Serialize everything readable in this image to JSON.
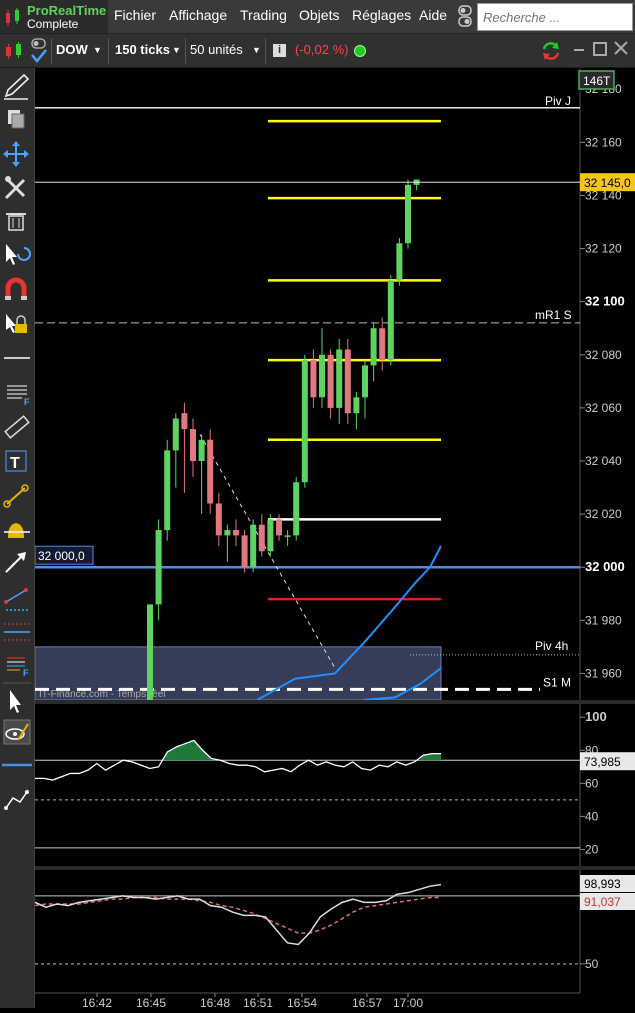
{
  "app": {
    "name": "ProRealTime",
    "edition": "Complete"
  },
  "menu": [
    "Fichier",
    "Affichage",
    "Trading",
    "Objets",
    "Réglages",
    "Aide"
  ],
  "search": {
    "placeholder": "Recherche ..."
  },
  "toolbar": {
    "instrument": "DOW",
    "period": "150 ticks",
    "units": "50 unités",
    "change": "(-0,02 %)",
    "colors": {
      "change": "#ff4444",
      "status": "#22cc22"
    }
  },
  "tools": [
    "pencil-icon",
    "copy-icon",
    "move-icon",
    "tools-icon",
    "trash-icon",
    "cursor-undo-icon",
    "magnet-icon",
    "lock-cursor-icon",
    "horizontal-line-icon",
    "fibonacci-icon",
    "ruler-icon",
    "text-icon",
    "segment-icon",
    "alert-icon",
    "arrow-icon",
    "channel-icon",
    "fork-icon",
    "fan-icon",
    "pointer-icon",
    "eye-pencil-icon",
    "blue-line-icon",
    "polyline-icon"
  ],
  "chart_data": [
    {
      "type": "candlestick",
      "ticks_badge": "146T",
      "ylim": [
        31950,
        32188
      ],
      "yticks": [
        "32 180",
        "32 160",
        "32 140",
        "32 120",
        "32 100",
        "32 080",
        "32 060",
        "32 040",
        "32 020",
        "32 000",
        "31 980",
        "31 960"
      ],
      "price_marker": "32 145,0",
      "level_marker": "32 000,0",
      "watermark": "IT-Finance.com - Temps réel",
      "level_labels": {
        "piv_j": "Piv J",
        "mr1_s": "mR1 S",
        "piv_4h": "Piv 4h",
        "s1_m": "S1 M"
      },
      "levels": {
        "piv_j": 32173,
        "mr1_s": 32092,
        "piv_4h": 31967,
        "s1_m": 31954,
        "blue": 32000
      },
      "fib_lines": {
        "yellow": [
          32168,
          32139,
          32108,
          32078,
          32048
        ],
        "white": 32018,
        "red": 31988
      },
      "candles": [
        {
          "o": 31950,
          "h": 31986,
          "l": 31950,
          "c": 31986
        },
        {
          "o": 31986,
          "h": 32018,
          "l": 31980,
          "c": 32014
        },
        {
          "o": 32014,
          "h": 32048,
          "l": 32010,
          "c": 32044
        },
        {
          "o": 32044,
          "h": 32058,
          "l": 32030,
          "c": 32056
        },
        {
          "o": 32058,
          "h": 32062,
          "l": 32028,
          "c": 32052
        },
        {
          "o": 32052,
          "h": 32056,
          "l": 32034,
          "c": 32040
        },
        {
          "o": 32040,
          "h": 32050,
          "l": 32020,
          "c": 32048
        },
        {
          "o": 32048,
          "h": 32052,
          "l": 32020,
          "c": 32024
        },
        {
          "o": 32024,
          "h": 32028,
          "l": 32008,
          "c": 32012
        },
        {
          "o": 32012,
          "h": 32016,
          "l": 32002,
          "c": 32014
        },
        {
          "o": 32014,
          "h": 32018,
          "l": 32008,
          "c": 32012
        },
        {
          "o": 32012,
          "h": 32014,
          "l": 31998,
          "c": 32000
        },
        {
          "o": 32000,
          "h": 32018,
          "l": 31998,
          "c": 32016
        },
        {
          "o": 32016,
          "h": 32020,
          "l": 32004,
          "c": 32006
        },
        {
          "o": 32006,
          "h": 32020,
          "l": 32004,
          "c": 32018
        },
        {
          "o": 32018,
          "h": 32020,
          "l": 32010,
          "c": 32012
        },
        {
          "o": 32012,
          "h": 32014,
          "l": 32008,
          "c": 32012
        },
        {
          "o": 32012,
          "h": 32034,
          "l": 32010,
          "c": 32032
        },
        {
          "o": 32032,
          "h": 32080,
          "l": 32030,
          "c": 32078
        },
        {
          "o": 32078,
          "h": 32082,
          "l": 32060,
          "c": 32064
        },
        {
          "o": 32064,
          "h": 32090,
          "l": 32060,
          "c": 32080
        },
        {
          "o": 32080,
          "h": 32082,
          "l": 32056,
          "c": 32060
        },
        {
          "o": 32060,
          "h": 32086,
          "l": 32054,
          "c": 32082
        },
        {
          "o": 32082,
          "h": 32086,
          "l": 32054,
          "c": 32058
        },
        {
          "o": 32058,
          "h": 32066,
          "l": 32052,
          "c": 32064
        },
        {
          "o": 32064,
          "h": 32078,
          "l": 32056,
          "c": 32076
        },
        {
          "o": 32076,
          "h": 32092,
          "l": 32070,
          "c": 32090
        },
        {
          "o": 32090,
          "h": 32094,
          "l": 32074,
          "c": 32078
        },
        {
          "o": 32078,
          "h": 32110,
          "l": 32076,
          "c": 32108
        },
        {
          "o": 32108,
          "h": 32124,
          "l": 32106,
          "c": 32122
        },
        {
          "o": 32122,
          "h": 32146,
          "l": 32120,
          "c": 32144
        },
        {
          "o": 32144,
          "h": 32146,
          "l": 32142,
          "c": 32146
        }
      ]
    },
    {
      "type": "line",
      "ylim": [
        10,
        108
      ],
      "yticks": [
        "100",
        "80",
        "60",
        "40",
        "20"
      ],
      "value_label": "73,985",
      "upper": 74,
      "lower": 21,
      "mid": 50,
      "values": [
        63,
        63,
        62,
        64,
        66,
        66,
        68,
        72,
        68,
        71,
        74,
        73,
        71,
        69,
        70,
        79,
        82,
        84,
        86,
        80,
        75,
        74,
        72,
        71,
        71,
        70,
        67,
        68,
        69,
        67,
        71,
        74,
        71,
        73,
        71,
        70,
        73,
        69,
        68,
        71,
        70,
        73,
        71,
        73,
        77,
        78,
        78
      ]
    },
    {
      "type": "line",
      "ylim": [
        32,
        108
      ],
      "yticks": [
        "50"
      ],
      "value_labels": [
        "98,993",
        "91,037"
      ],
      "upper": 92,
      "lower": 28,
      "mid": 50,
      "series_a": [
        88,
        85,
        87,
        86,
        88,
        89,
        90,
        91,
        92,
        91,
        91,
        90,
        91,
        92,
        90,
        90,
        86,
        85,
        82,
        80,
        80,
        79,
        71,
        63,
        62,
        69,
        79,
        84,
        88,
        90,
        88,
        88,
        89,
        93,
        94,
        96,
        98,
        99
      ],
      "series_b": [
        86,
        87,
        87,
        87,
        87,
        88,
        89,
        90,
        90,
        91,
        91,
        91,
        90,
        90,
        90,
        89,
        88,
        86,
        85,
        83,
        81,
        78,
        75,
        72,
        69,
        69,
        71,
        74,
        78,
        82,
        85,
        86,
        87,
        88,
        89,
        90,
        91,
        91
      ]
    },
    {
      "type": "axis",
      "xticks": [
        "16:42",
        "16:45",
        "16:48",
        "16:51",
        "16:54",
        "16:57",
        "17:00"
      ]
    }
  ]
}
